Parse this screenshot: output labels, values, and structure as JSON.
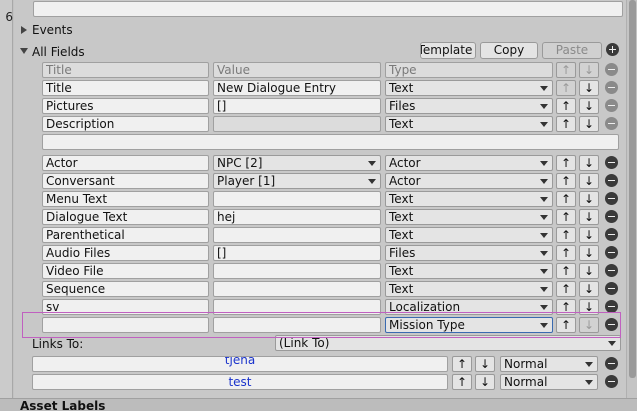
{
  "left_number": "6",
  "events_label": "Events",
  "all_fields_label": "All Fields",
  "buttons": {
    "template": "Template",
    "copy": "Copy",
    "paste": "Paste"
  },
  "columns": {
    "title": "Title",
    "value": "Value",
    "type": "Type"
  },
  "group1": [
    {
      "title": "Title",
      "value": "New Dialogue Entry",
      "type": "Text"
    },
    {
      "title": "Pictures",
      "value": "[]",
      "type": "Files"
    },
    {
      "title": "Description",
      "value": "",
      "type": "Text"
    }
  ],
  "group2": [
    {
      "title": "Actor",
      "value": "NPC [2]",
      "type": "Actor"
    },
    {
      "title": "Conversant",
      "value": "Player [1]",
      "type": "Actor"
    },
    {
      "title": "Menu Text",
      "value": "",
      "type": "Text"
    },
    {
      "title": "Dialogue Text",
      "value": "hej",
      "type": "Text"
    },
    {
      "title": "Parenthetical",
      "value": "",
      "type": "Text"
    },
    {
      "title": "Audio Files",
      "value": "[]",
      "type": "Files"
    },
    {
      "title": "Video File",
      "value": "",
      "type": "Text"
    },
    {
      "title": "Sequence",
      "value": "",
      "type": "Text"
    },
    {
      "title": "sv",
      "value": "",
      "type": "Localization"
    }
  ],
  "new_field": {
    "title": "",
    "value": "",
    "type": "Mission Type"
  },
  "links_to_label": "Links To:",
  "links_to_value": "(Link To)",
  "links": [
    {
      "name": "tjena",
      "priority": "Normal"
    },
    {
      "name": "test",
      "priority": "Normal"
    }
  ],
  "asset_labels": "Asset Labels",
  "glyphs": {
    "up": "↑",
    "down": "↓"
  }
}
